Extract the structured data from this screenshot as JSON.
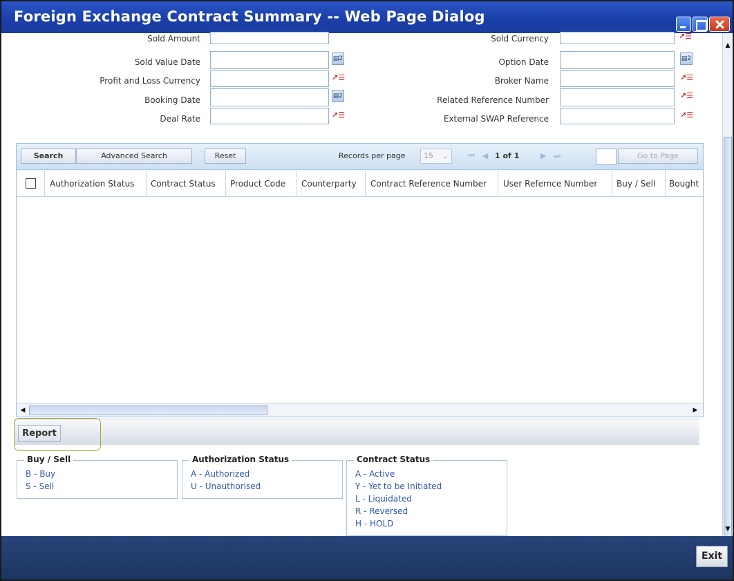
{
  "window": {
    "title": "Foreign Exchange Contract Summary -- Web Page Dialog"
  },
  "form": {
    "left": [
      {
        "label": "Sold Amount",
        "value": "",
        "icon": ""
      },
      {
        "label": "Sold Value Date",
        "value": "",
        "icon": "calendar-icon"
      },
      {
        "label": "Profit and Loss Currency",
        "value": "",
        "icon": "list-of-values-icon"
      },
      {
        "label": "Booking Date",
        "value": "",
        "icon": "calendar-icon"
      },
      {
        "label": "Deal Rate",
        "value": "",
        "icon": "list-of-values-icon"
      }
    ],
    "right": [
      {
        "label": "Sold Currency",
        "value": "",
        "icon": "list-of-values-icon"
      },
      {
        "label": "Option Date",
        "value": "",
        "icon": "calendar-icon"
      },
      {
        "label": "Broker Name",
        "value": "",
        "icon": "list-of-values-icon"
      },
      {
        "label": "Related Reference Number",
        "value": "",
        "icon": "list-of-values-icon"
      },
      {
        "label": "External SWAP Reference",
        "value": "",
        "icon": "list-of-values-icon"
      }
    ]
  },
  "toolbar": {
    "search": "Search",
    "advanced_search": "Advanced Search",
    "reset": "Reset",
    "records_per_page_label": "Records per page",
    "records_per_page_value": "15",
    "page_current": "1",
    "page_of": "of",
    "page_total": "1",
    "go_to_page": "Go to Page"
  },
  "table": {
    "columns": [
      "Authorization Status",
      "Contract Status",
      "Product Code",
      "Counterparty",
      "Contract Reference Number",
      "User Refernce Number",
      "Buy / Sell",
      "Bought"
    ],
    "rows": []
  },
  "report": {
    "label": "Report"
  },
  "legends": {
    "buy_sell": {
      "title": "Buy / Sell",
      "items": [
        "B - Buy",
        "S - Sell"
      ]
    },
    "authorization_status": {
      "title": "Authorization Status",
      "items": [
        "A - Authorized",
        "U - Unauthorised"
      ]
    },
    "contract_status": {
      "title": "Contract Status",
      "items": [
        "A - Active",
        "Y - Yet to be Initiated",
        "L - Liquidated",
        "R - Reversed",
        "H - HOLD"
      ]
    }
  },
  "footer": {
    "exit": "Exit"
  },
  "colors": {
    "title_bar": "#1f47b6",
    "footer": "#22406f",
    "legend_text": "#2f57b4",
    "lov_icon": "#d5201c"
  }
}
